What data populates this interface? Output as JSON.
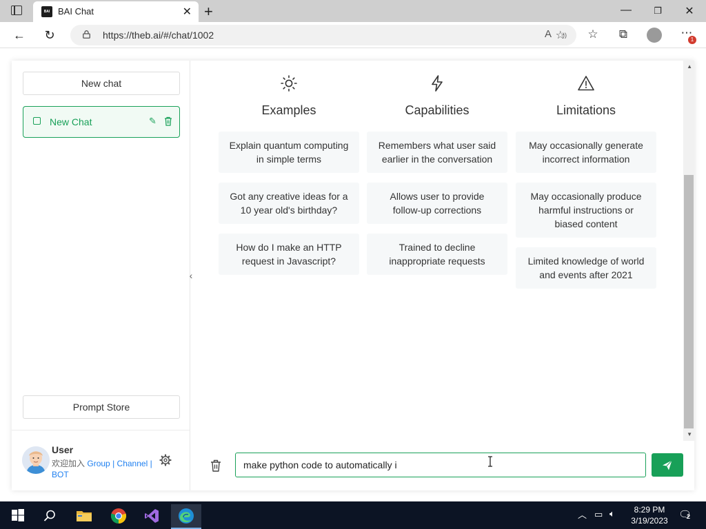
{
  "browser": {
    "tab_title": "BAI Chat",
    "tab_favicon_text": "BAI",
    "url": "https://theb.ai/#/chat/1002",
    "notification_count": "1"
  },
  "sidebar": {
    "new_chat_label": "New chat",
    "chats": [
      {
        "label": "New Chat",
        "active": true
      }
    ],
    "prompt_store_label": "Prompt Store",
    "user": {
      "name": "User",
      "join_text": "欢迎加入",
      "links": [
        "Group",
        "Channel",
        "BOT"
      ],
      "sep": "|"
    }
  },
  "main": {
    "columns": [
      {
        "icon": "sun-icon",
        "title": "Examples",
        "cards": [
          "Explain quantum computing in simple terms",
          "Got any creative ideas for a 10 year old's birthday?",
          "How do I make an HTTP request in Javascript?"
        ]
      },
      {
        "icon": "lightning-icon",
        "title": "Capabilities",
        "cards": [
          "Remembers what user said earlier in the conversation",
          "Allows user to provide follow-up corrections",
          "Trained to decline inappropriate requests"
        ]
      },
      {
        "icon": "warning-icon",
        "title": "Limitations",
        "cards": [
          "May occasionally generate incorrect information",
          "May occasionally produce harmful instructions or biased content",
          "Limited knowledge of world and events after 2021"
        ]
      }
    ],
    "input_value": "make python code to automatically i"
  },
  "taskbar": {
    "time": "8:29 PM",
    "date": "3/19/2023",
    "notification_count": "2"
  },
  "colors": {
    "accent": "#18a058",
    "link": "#2080f0",
    "taskbar": "#0c1424"
  }
}
